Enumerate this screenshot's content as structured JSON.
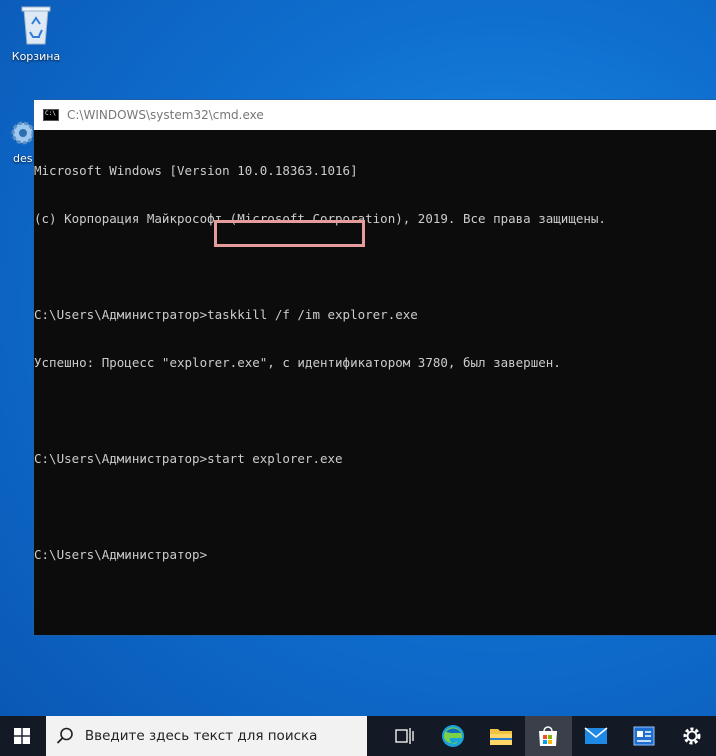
{
  "desktop": {
    "icons": [
      {
        "label": "Корзина",
        "icon": "recycle-bin-icon"
      },
      {
        "label": "des",
        "icon": "settings-shortcut-icon"
      }
    ]
  },
  "window": {
    "title": "C:\\WINDOWS\\system32\\cmd.exe",
    "icon": "console-icon"
  },
  "console": {
    "lines": [
      "Microsoft Windows [Version 10.0.18363.1016]",
      "(c) Корпорация Майкрософт (Microsoft Corporation), 2019. Все права защищены.",
      "",
      "C:\\Users\\Администратор>taskkill /f /im explorer.exe",
      "Успешно: Процесс \"explorer.exe\", с идентификатором 3780, был завершен.",
      "",
      "C:\\Users\\Администратор>start explorer.exe",
      "",
      "C:\\Users\\Администратор>"
    ],
    "highlighted_command": "start explorer.exe",
    "highlight_color": "#e49c9c"
  },
  "taskbar": {
    "search_placeholder": "Введите здесь текст для поиска",
    "apps": [
      "task-view-icon",
      "edge-icon",
      "file-explorer-icon",
      "store-icon",
      "mail-icon",
      "news-icon",
      "settings-icon"
    ],
    "background": "#131a26"
  }
}
